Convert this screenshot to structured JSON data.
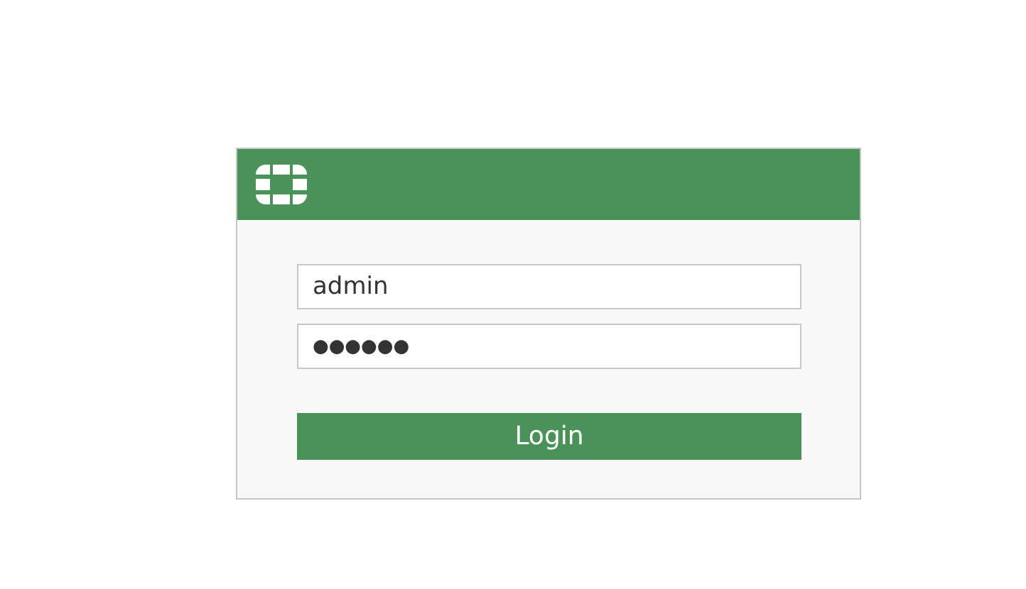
{
  "username": {
    "value": "admin"
  },
  "password": {
    "value": "●●●●●●"
  },
  "button": {
    "label": "Login"
  }
}
